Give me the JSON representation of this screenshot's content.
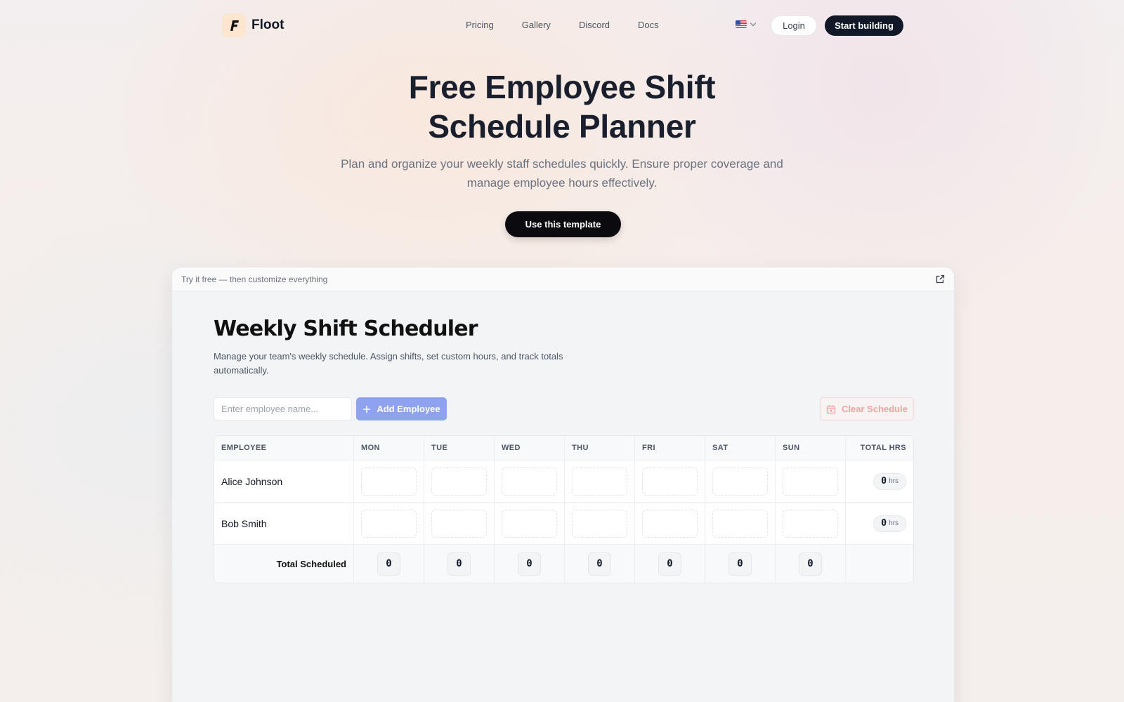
{
  "nav": {
    "brand": "Floot",
    "links": [
      "Pricing",
      "Gallery",
      "Discord",
      "Docs"
    ],
    "login": "Login",
    "start": "Start building"
  },
  "hero": {
    "title_line1": "Free Employee Shift",
    "title_line2": "Schedule Planner",
    "subtitle": "Plan and organize your weekly staff schedules quickly. Ensure proper coverage and manage employee hours effectively.",
    "cta": "Use this template"
  },
  "preview": {
    "bar_text": "Try it free — then customize everything"
  },
  "app": {
    "title": "Weekly Shift Scheduler",
    "description": "Manage your team's weekly schedule. Assign shifts, set custom hours, and track totals automatically.",
    "input_placeholder": "Enter employee name...",
    "add_button": "Add Employee",
    "clear_button": "Clear Schedule",
    "table": {
      "headers": [
        "EMPLOYEE",
        "MON",
        "TUE",
        "WED",
        "THU",
        "FRI",
        "SAT",
        "SUN",
        "TOTAL HRS"
      ],
      "rows": [
        {
          "name": "Alice Johnson",
          "total": "0",
          "unit": "hrs"
        },
        {
          "name": "Bob Smith",
          "total": "0",
          "unit": "hrs"
        }
      ],
      "total_label": "Total Scheduled",
      "day_totals": [
        "0",
        "0",
        "0",
        "0",
        "0",
        "0",
        "0"
      ]
    }
  },
  "colors": {
    "accent": "#8ea2f0",
    "danger": "#f1a3a3",
    "dark": "#111827"
  }
}
